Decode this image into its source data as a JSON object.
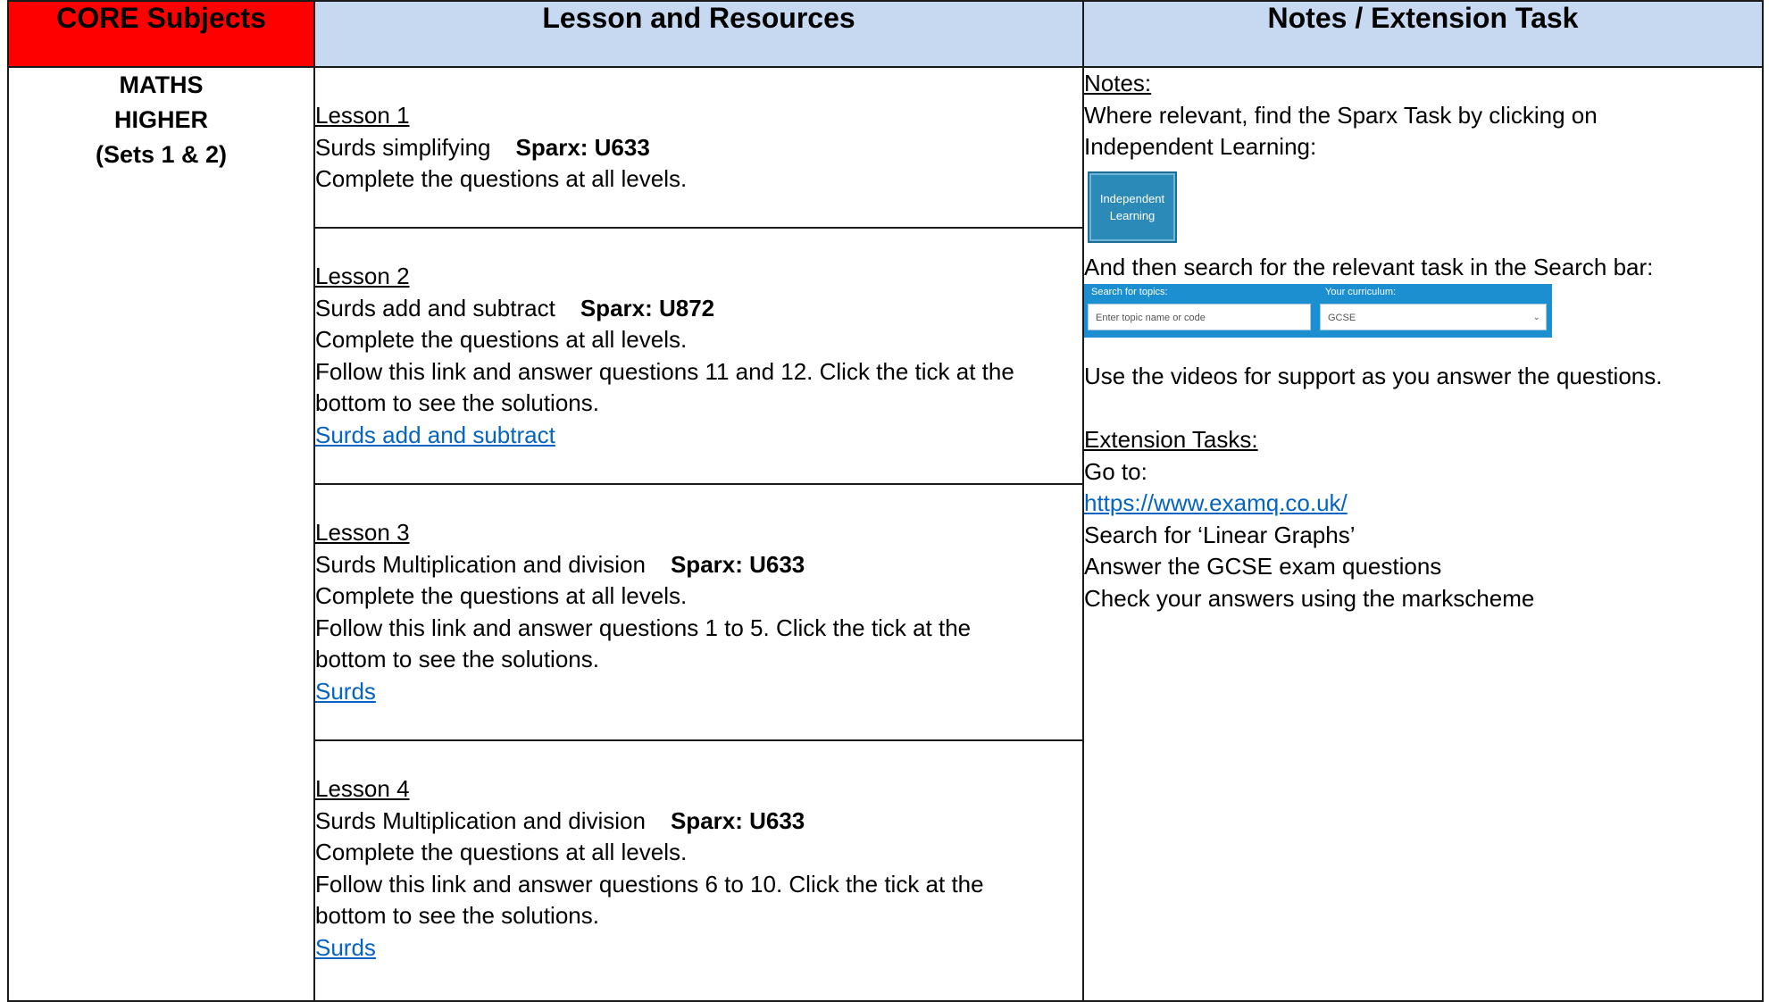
{
  "header": {
    "col1": "CORE Subjects",
    "col2": "Lesson and Resources",
    "col3": "Notes / Extension Task"
  },
  "subject": {
    "line1": "MATHS",
    "line2": "HIGHER",
    "line3": "(Sets 1 & 2)"
  },
  "lessons": [
    {
      "title": "Lesson 1",
      "topic": "Surds simplifying",
      "sparx": "Sparx: U633",
      "instruction": "Complete the questions at all levels."
    },
    {
      "title": "Lesson 2",
      "topic": "Surds add and subtract",
      "sparx": "Sparx: U872",
      "instruction": "Complete the questions at all levels.",
      "follow_1": "Follow this link and answer questions 11 and 12. Click the tick at the",
      "follow_2": "bottom to see the solutions.",
      "link": "Surds add and subtract"
    },
    {
      "title": "Lesson 3",
      "topic": "Surds Multiplication and division",
      "sparx": "Sparx: U633",
      "instruction": "Complete the questions at all levels.",
      "follow_1": "Follow this link and answer questions 1 to 5. Click the tick at the",
      "follow_2": "bottom to see the solutions.",
      "link": "Surds"
    },
    {
      "title": "Lesson 4",
      "topic": "Surds Multiplication and division",
      "sparx": "Sparx: U633",
      "instruction": "Complete the questions at all levels.",
      "follow_1": "Follow this link and answer questions 6 to 10. Click the tick at the",
      "follow_2": "bottom to see the solutions.",
      "link": "Surds"
    }
  ],
  "notes": {
    "heading": "Notes:",
    "text_1": "Where relevant, find the Sparx Task by clicking on",
    "text_2": "Independent Learning:",
    "il_button": {
      "line1": "Independent",
      "line2": "Learning",
      "color": "#2b8ab7"
    },
    "search_text": "And then search for the relevant task in the Search bar:",
    "searchbar": {
      "label_topics": "Search for topics:",
      "label_curriculum": "Your curriculum:",
      "placeholder": "Enter topic name or code",
      "curriculum_value": "GCSE",
      "color": "#1c8fd0"
    },
    "videos": "Use the videos for support as you answer the questions.",
    "extension_heading": "Extension Tasks:",
    "go_to": "Go to:",
    "url": "https://www.examq.co.uk/",
    "search_for": "Search for ‘Linear Graphs’",
    "answer": "Answer the GCSE exam questions",
    "check": "Check your answers using the markscheme"
  },
  "colors": {
    "core_header": "#ff0000",
    "header_bg": "#c6d9f1",
    "link": "#0563c1"
  }
}
